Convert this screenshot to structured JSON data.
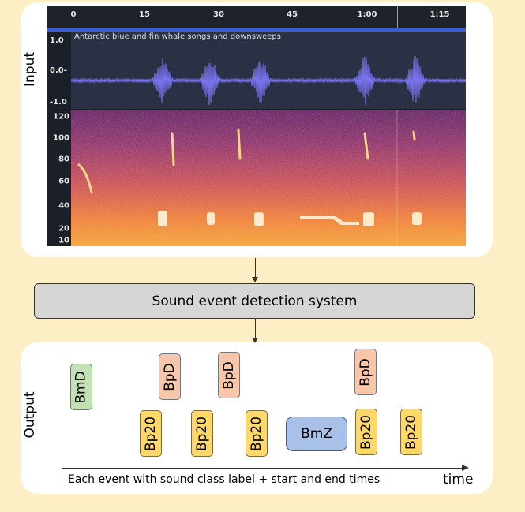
{
  "input_label": "Input",
  "output_label": "Output",
  "audio_view": {
    "time_ticks": [
      "0",
      "15",
      "30",
      "45",
      "1:00",
      "1:15"
    ],
    "waveform_title": "Antarctic blue and fin whale songs and downsweeps",
    "amplitude_ticks": [
      "1.0",
      "0.0-",
      "-1.0"
    ],
    "frequency_ticks": [
      "120",
      "100",
      "80",
      "60",
      "40",
      "20",
      "10"
    ],
    "waveform_color": "#7a74f0"
  },
  "system_label": "Sound event detection system",
  "events": [
    {
      "label": "BmD",
      "class": "bmd"
    },
    {
      "label": "BpD",
      "class": "bpd"
    },
    {
      "label": "BpD",
      "class": "bpd"
    },
    {
      "label": "BpD",
      "class": "bpd"
    },
    {
      "label": "Bp20",
      "class": "bp20"
    },
    {
      "label": "Bp20",
      "class": "bp20"
    },
    {
      "label": "Bp20",
      "class": "bp20"
    },
    {
      "label": "BmZ",
      "class": "bmz"
    },
    {
      "label": "Bp20",
      "class": "bp20"
    },
    {
      "label": "Bp20",
      "class": "bp20"
    }
  ],
  "caption": "Each event with sound class label + start and end times",
  "time_label": "time",
  "colors": {
    "background": "#fcefc6",
    "bmd": "#c4e0b5",
    "bpd": "#f8c6a8",
    "bp20": "#ffd867",
    "bmz": "#a9c1e8"
  }
}
